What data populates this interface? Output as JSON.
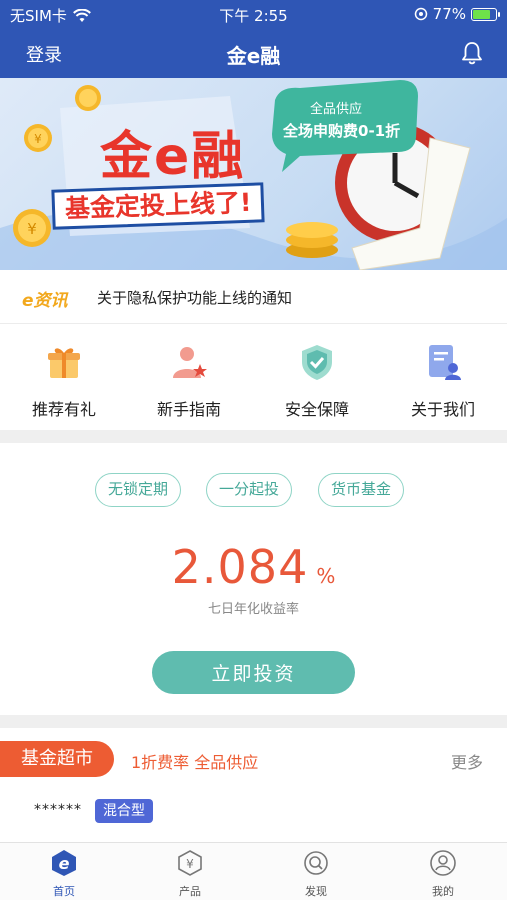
{
  "status_bar": {
    "carrier": "无SIM卡",
    "time": "下午 2:55",
    "battery": "77%",
    "battery_level": 0.77
  },
  "nav": {
    "login": "登录",
    "title": "金e融"
  },
  "banner": {
    "brand": "金e融",
    "headline": "基金定投上线了!",
    "bubble_line1": "全品供应",
    "bubble_line2": "全场申购费0-1折",
    "bg_color": "#c7dcf3"
  },
  "notice": {
    "logo": "e资讯",
    "text": "关于隐私保护功能上线的通知"
  },
  "quick_links": [
    {
      "label": "推荐有礼",
      "icon": "gift-icon"
    },
    {
      "label": "新手指南",
      "icon": "user-star-icon"
    },
    {
      "label": "安全保障",
      "icon": "shield-check-icon"
    },
    {
      "label": "关于我们",
      "icon": "document-user-icon"
    }
  ],
  "promo": {
    "tags": [
      "无锁定期",
      "一分起投",
      "货币基金"
    ],
    "rate": "2.084",
    "rate_unit": "%",
    "rate_caption": "七日年化收益率",
    "button": "立即投资",
    "accent": "#5fbcaf",
    "rate_color": "#e8583a"
  },
  "market": {
    "tag": "基金超市",
    "subtitle": "1折费率 全品供应",
    "more": "更多",
    "fund": {
      "name": "******",
      "type": "混合型"
    }
  },
  "tabs": [
    {
      "label": "首页",
      "icon": "home-e-icon",
      "active": true
    },
    {
      "label": "产品",
      "icon": "product-yen-icon",
      "active": false
    },
    {
      "label": "发现",
      "icon": "discover-search-icon",
      "active": false
    },
    {
      "label": "我的",
      "icon": "profile-icon",
      "active": false
    }
  ],
  "colors": {
    "primary": "#2f56b5",
    "orange": "#ed5c33"
  }
}
